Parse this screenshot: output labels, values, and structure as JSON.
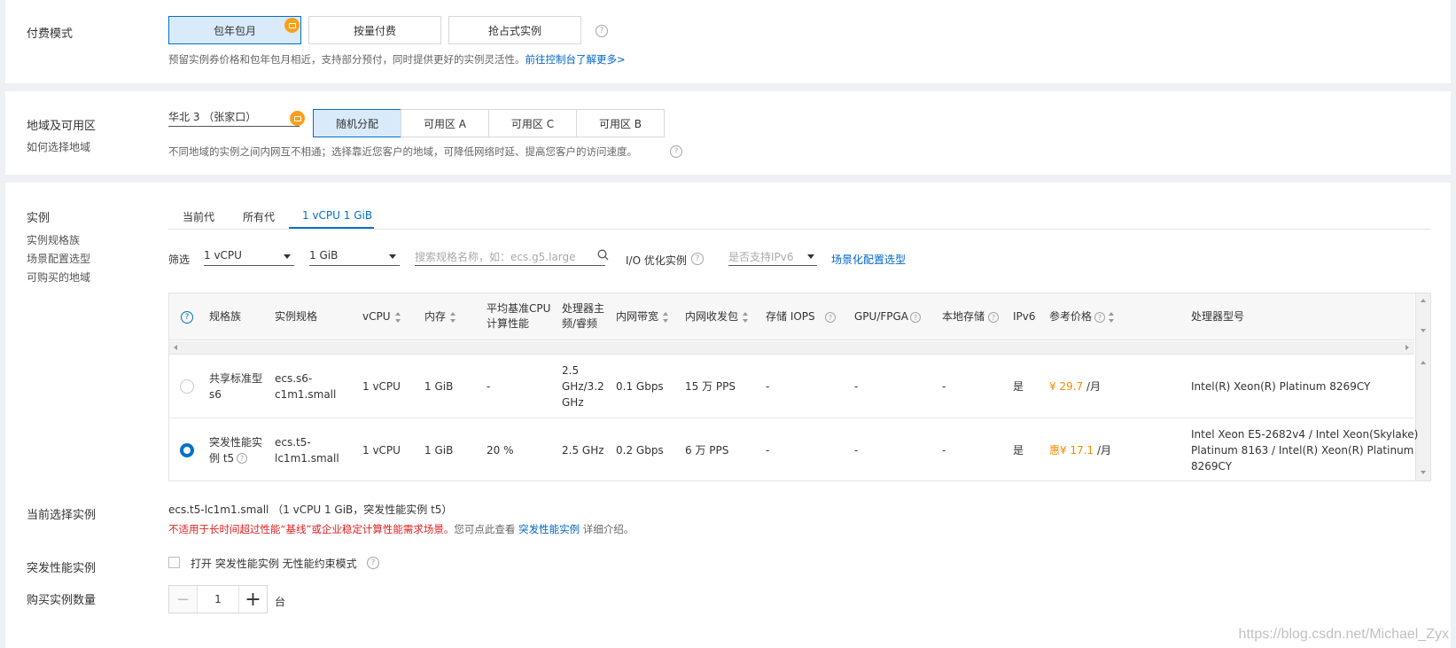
{
  "billing": {
    "label": "付费模式",
    "options": [
      "包年包月",
      "按量付费",
      "抢占式实例"
    ],
    "selected_index": 0,
    "hint": "预留实例券价格和包年包月相近，支持部分预付，同时提供更好的实例灵活性。",
    "hint_link": "前往控制台了解更多>"
  },
  "region": {
    "label": "地域及可用区",
    "sublink": "如何选择地域",
    "region_value": "华北 3 （张家口）",
    "zones": [
      "随机分配",
      "可用区 A",
      "可用区 C",
      "可用区 B"
    ],
    "selected_zone_index": 0,
    "hint": "不同地域的实例之间内网互不相通；选择靠近您客户的地域，可降低网络时延、提高您客户的访问速度。"
  },
  "instance": {
    "label": "实例",
    "sublinks": [
      "实例规格族",
      "场景配置选型",
      "可购买的地域"
    ],
    "tabs": [
      "当前代",
      "所有代",
      "1 vCPU 1 GiB"
    ],
    "active_tab_index": 2,
    "filter": {
      "label": "筛选",
      "vcpu": "1 vCPU",
      "memory": "1 GiB",
      "search_placeholder": "搜索规格名称，如：ecs.g5.large",
      "io_label": "I/O 优化实例",
      "ipv6_placeholder": "是否支持IPv6",
      "scene_link": "场景化配置选型"
    },
    "columns": {
      "family": "规格族",
      "spec": "实例规格",
      "vcpu": "vCPU",
      "memory": "内存",
      "baseline_1": "平均基准CPU",
      "baseline_2": "计算性能",
      "freq_1": "处理器主",
      "freq_2": "频/睿频",
      "bandwidth": "内网带宽",
      "pps": "内网收发包",
      "iops": "存储 IOPS",
      "gpu": "GPU/FPGA",
      "local_storage": "本地存储",
      "ipv6": "IPv6",
      "price": "参考价格",
      "cpu_model": "处理器型号"
    },
    "rows": [
      {
        "family_1": "共享标准型",
        "family_2": "s6",
        "spec_1": "ecs.s6-",
        "spec_2": "c1m1.small",
        "vcpu": "1 vCPU",
        "memory": "1 GiB",
        "baseline": "-",
        "freq_1": "2.5",
        "freq_2": "GHz/3.2",
        "freq_3": "GHz",
        "bandwidth": "0.1 Gbps",
        "pps": "15 万 PPS",
        "iops": "-",
        "gpu": "-",
        "local_storage": "-",
        "ipv6": "是",
        "price_prefix": "",
        "price": "¥ 29.7",
        "price_unit": "/月",
        "cpu_model_1": "Intel(R) Xeon(R) Platinum 8269CY",
        "cpu_model_2": "",
        "cpu_model_3": "",
        "selected": false
      },
      {
        "family_1": "突发性能实",
        "family_2": "例 t5",
        "spec_1": "ecs.t5-",
        "spec_2": "lc1m1.small",
        "vcpu": "1 vCPU",
        "memory": "1 GiB",
        "baseline": "20 %",
        "freq_1": "2.5 GHz",
        "freq_2": "",
        "freq_3": "",
        "bandwidth": "0.2 Gbps",
        "pps": "6 万 PPS",
        "iops": "-",
        "gpu": "-",
        "local_storage": "-",
        "ipv6": "是",
        "price_prefix": "惠",
        "price": "¥ 17.1",
        "price_unit": "/月",
        "cpu_model_1": "Intel Xeon E5-2682v4 / Intel Xeon(Skylake)",
        "cpu_model_2": "Platinum 8163 / Intel(R) Xeon(R) Platinum",
        "cpu_model_3": "8269CY",
        "selected": true
      }
    ]
  },
  "current": {
    "label": "当前选择实例",
    "value": "ecs.t5-lc1m1.small （1 vCPU 1 GiB，突发性能实例 t5）",
    "warning": "不适用于长时间超过性能“基线”或企业稳定计算性能需求场景。",
    "note_pre": "您可点此查看",
    "note_link": "突发性能实例",
    "note_post": "详细介绍。"
  },
  "burst": {
    "label": "突发性能实例",
    "checkbox_label": "打开 突发性能实例 无性能约束模式"
  },
  "quantity": {
    "label": "购买实例数量",
    "value": "1",
    "unit": "台"
  },
  "watermark": "https://blog.csdn.net/Michael_Zyx",
  "colors": {
    "accent": "#0070cc",
    "link": "#0064c8",
    "warning": "#e02020",
    "price": "#f08c00",
    "badge": "#f7a01b"
  }
}
